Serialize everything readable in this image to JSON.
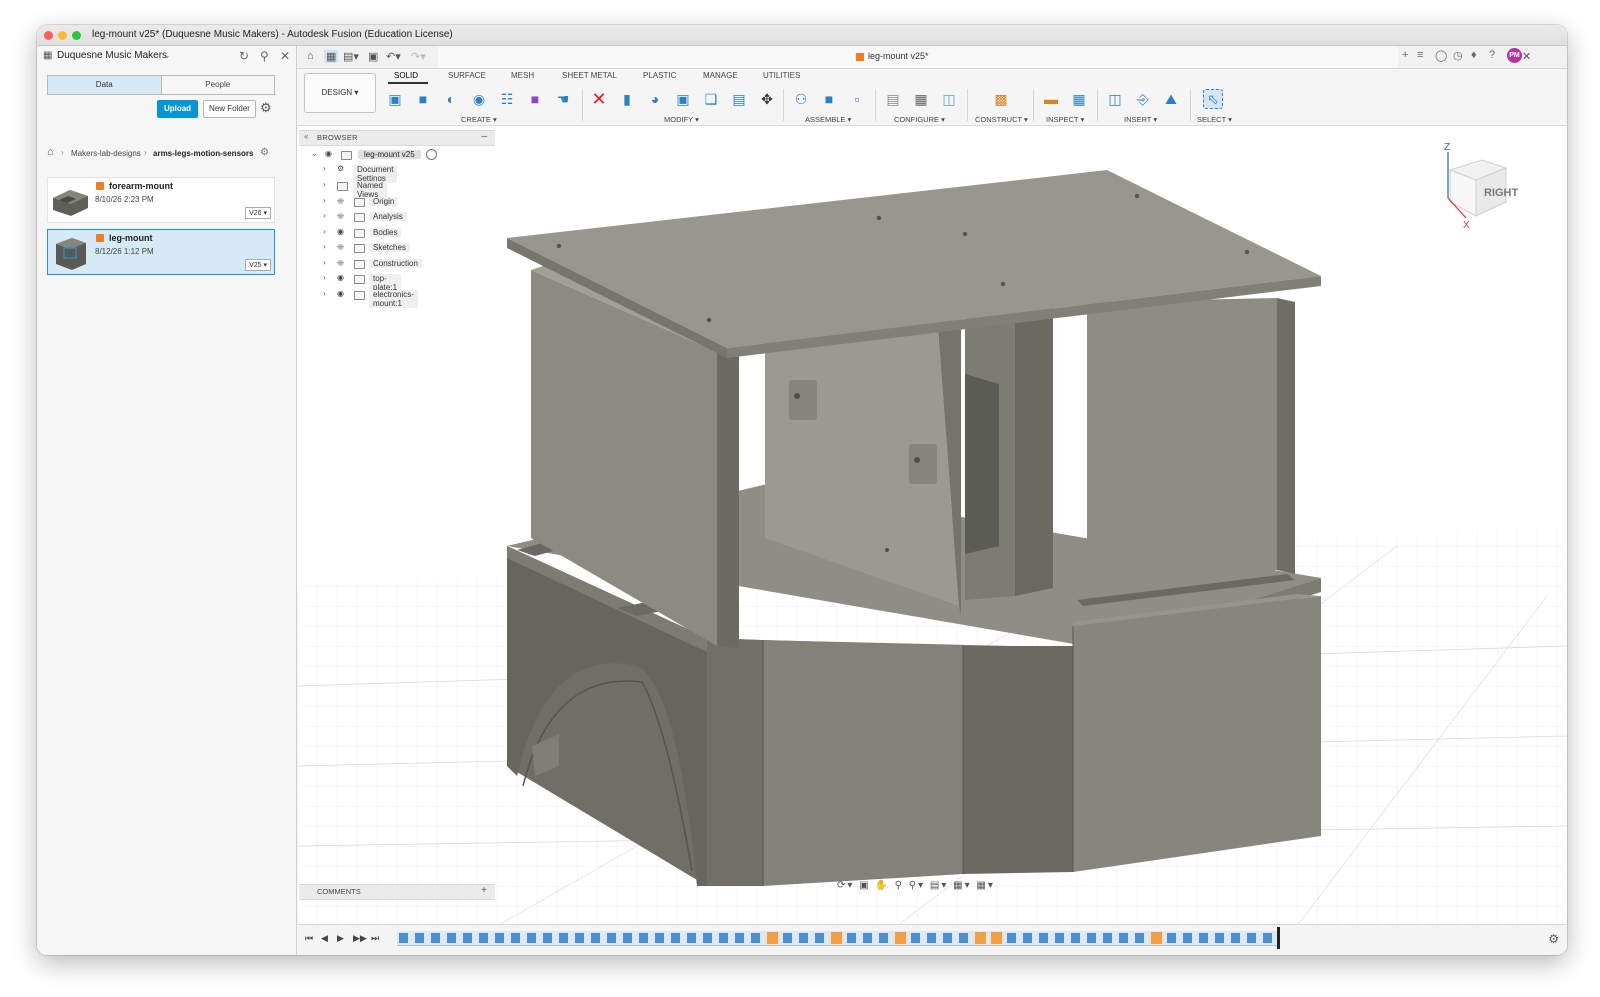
{
  "window": {
    "title": "leg-mount v25* (Duquesne Music Makers) - Autodesk Fusion (Education License)"
  },
  "data_panel": {
    "team_name": "Duquesne Music Makers",
    "tabs": [
      "Data",
      "People"
    ],
    "upload_label": "Upload",
    "new_folder_label": "New Folder",
    "breadcrumb": [
      "Makers-lab-designs",
      "arms-legs-motion-sensors"
    ],
    "files": [
      {
        "name": "forearm-mount",
        "date": "8/10/26 2:23 PM",
        "version": "V26 ▾"
      },
      {
        "name": "leg-mount",
        "date": "8/12/26 1:12 PM",
        "version": "V25 ▾"
      }
    ]
  },
  "document": {
    "tab_title": "leg-mount v25*",
    "avatar_initials": "PM"
  },
  "toolbar": {
    "workspace": "DESIGN ▾",
    "tabs": [
      "SOLID",
      "SURFACE",
      "MESH",
      "SHEET METAL",
      "PLASTIC",
      "MANAGE",
      "UTILITIES"
    ],
    "groups": [
      "CREATE ▾",
      "MODIFY ▾",
      "ASSEMBLE ▾",
      "CONFIGURE ▾",
      "CONSTRUCT ▾",
      "INSPECT ▾",
      "INSERT ▾",
      "SELECT ▾"
    ]
  },
  "browser": {
    "header": "BROWSER",
    "root": "leg-mount v25",
    "items": [
      "Document Settings",
      "Named Views",
      "Origin",
      "Analysis",
      "Bodies",
      "Sketches",
      "Construction",
      "top-plate:1",
      "electronics-mount:1"
    ]
  },
  "comments": {
    "label": "COMMENTS"
  },
  "viewcube": {
    "face": "RIGHT",
    "axis_z": "Z",
    "axis_x": "X"
  },
  "colors": {
    "accent": "#0696d7",
    "model": "#8a8a7f",
    "model_dark": "#66665d",
    "model_light": "#a3a399",
    "grid": "#d9dde2"
  }
}
